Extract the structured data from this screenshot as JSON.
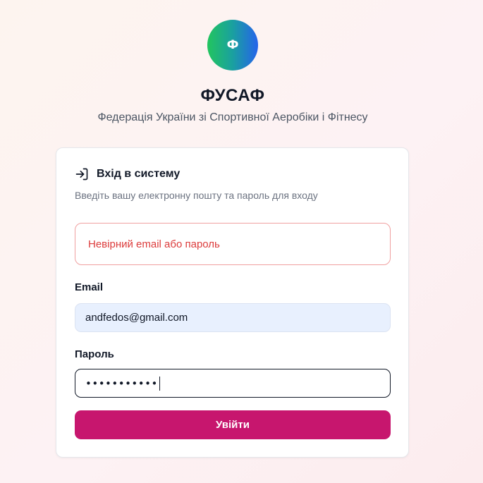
{
  "brand": {
    "logo_letter": "Ф",
    "title": "ФУСАФ",
    "subtitle": "Федерація України зі Спортивної Аеробіки і Фітнесу"
  },
  "login_card": {
    "icon": "log-in-icon",
    "title": "Вхід в систему",
    "description": "Введіть вашу електронну пошту та пароль для входу",
    "error_message": "Невірний email або пароль",
    "email": {
      "label": "Email",
      "value": "andfedos@gmail.com"
    },
    "password": {
      "label": "Пароль",
      "masked_value": "•••••••••••"
    },
    "submit_label": "Увійти"
  },
  "colors": {
    "accent": "#c7166e",
    "error": "#dc3c3c",
    "logo_gradient": [
      "#22c55e",
      "#2563eb"
    ]
  }
}
